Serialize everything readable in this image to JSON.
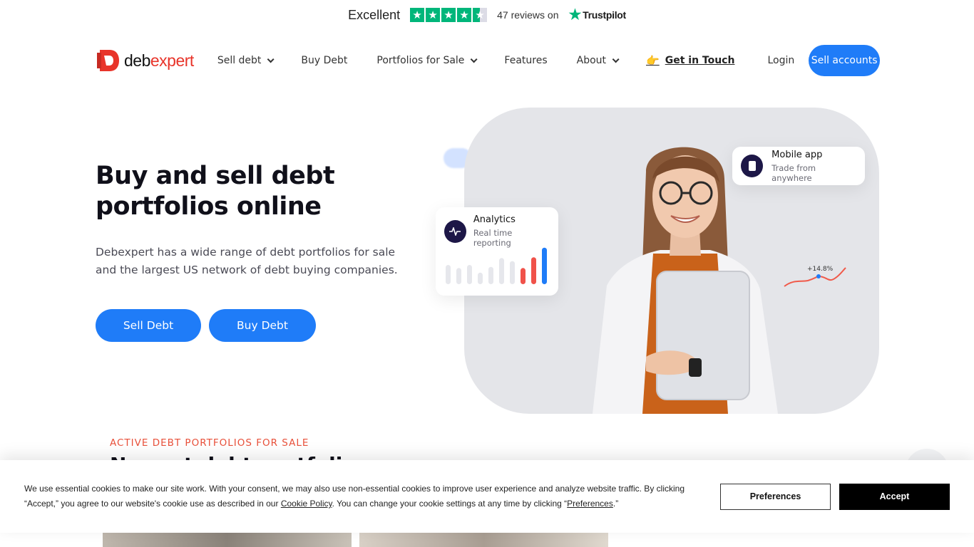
{
  "trustpilot": {
    "rating_label": "Excellent",
    "stars": 4.5,
    "reviews_text": "47 reviews on",
    "brand": "Trustpilot",
    "color": "#00b67a"
  },
  "header": {
    "logo_part1": "deb",
    "logo_part2": "expert",
    "nav": {
      "sell_debt": "Sell debt",
      "buy_debt": "Buy Debt",
      "portfolios": "Portfolios for Sale",
      "features": "Features",
      "about": "About",
      "get_in_touch": "Get in Touch",
      "login": "Login",
      "sell_accounts": "Sell accounts"
    }
  },
  "hero": {
    "title": "Buy and sell debt portfolios online",
    "description": "Debexpert has a wide range of debt portfolios for sale and the largest US network of debt buying companies.",
    "sell_button": "Sell Debt",
    "buy_button": "Buy Debt"
  },
  "cards": {
    "mobile_title": "Mobile app",
    "mobile_sub": "Trade from anywhere",
    "analytics_title": "Analytics",
    "analytics_sub": "Real time reporting",
    "analytics_bars": [
      0.5,
      0.42,
      0.5,
      0.3,
      0.45,
      0.68,
      0.6,
      0.42,
      0.7,
      0.95
    ],
    "trend_label": "+14.8%"
  },
  "section": {
    "kicker": "ACTIVE DEBT PORTFOLIOS FOR SALE",
    "title": "Newest debt portfolios"
  },
  "cookie": {
    "text_1": "We use essential cookies to make our site work. With your consent, we may also use non-essential cookies to improve user experience and analyze website traffic. By clicking “Accept,” you agree to our website's cookie use as described in our ",
    "policy_link": "Cookie Policy",
    "text_2": ". You can change your cookie settings at any time by clicking “",
    "preferences_link": "Preferences",
    "text_3": ".”",
    "preferences_button": "Preferences",
    "accept_button": "Accept"
  },
  "colors": {
    "primary": "#1f7cf8",
    "brand_red": "#e8342a",
    "navy": "#1d1747"
  }
}
